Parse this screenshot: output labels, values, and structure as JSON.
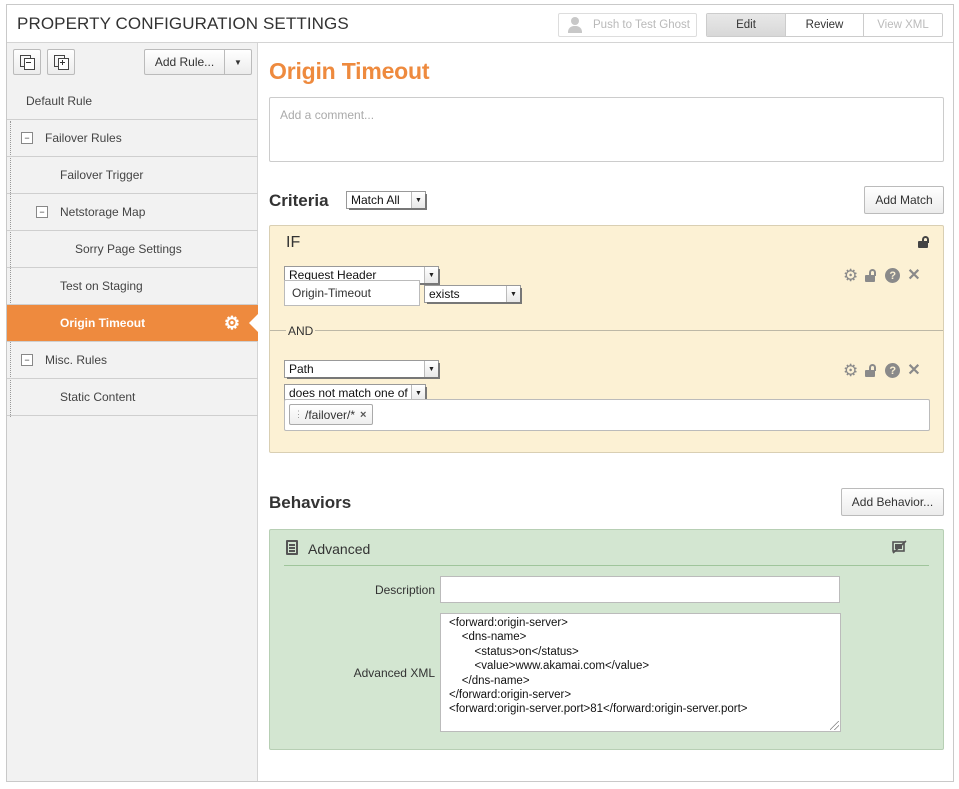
{
  "app": {
    "title": "PROPERTY CONFIGURATION SETTINGS",
    "push_button": "Push to Test Ghost",
    "modes": [
      "Edit",
      "Review",
      "View XML"
    ],
    "active_mode": "Edit"
  },
  "sidebar": {
    "add_rule_label": "Add Rule...",
    "rules": [
      {
        "label": "Default Rule",
        "level": 0,
        "toggle": ""
      },
      {
        "label": "Failover Rules",
        "level": 1,
        "toggle": "−"
      },
      {
        "label": "Failover Trigger",
        "level": 2,
        "toggle": ""
      },
      {
        "label": "Netstorage Map",
        "level": 2,
        "toggle": "−"
      },
      {
        "label": "Sorry Page Settings",
        "level": 3,
        "toggle": ""
      },
      {
        "label": "Test on Staging",
        "level": 2,
        "toggle": ""
      },
      {
        "label": "Origin Timeout",
        "level": 2,
        "toggle": "",
        "active": true
      },
      {
        "label": "Misc. Rules",
        "level": 1,
        "toggle": "−"
      },
      {
        "label": "Static Content",
        "level": 2,
        "toggle": ""
      }
    ]
  },
  "main": {
    "rule_title": "Origin Timeout",
    "comment_placeholder": "Add a comment...",
    "criteria": {
      "title": "Criteria",
      "match_mode": "Match All",
      "add_match_label": "Add Match",
      "if_label": "IF",
      "and_label": "AND",
      "condition1": {
        "type": "Request Header",
        "header_name": "Origin-Timeout",
        "operator": "exists"
      },
      "condition2": {
        "type": "Path",
        "operator": "does not match one of",
        "values": [
          "/failover/*"
        ]
      }
    },
    "behaviors": {
      "title": "Behaviors",
      "add_behavior_label": "Add Behavior...",
      "items": [
        {
          "name": "Advanced",
          "description_label": "Description",
          "description_value": "",
          "xml_label": "Advanced XML",
          "xml_value": "<forward:origin-server>\n    <dns-name>\n        <status>on</status>\n        <value>www.akamai.com</value>\n    </dns-name>\n</forward:origin-server>\n<forward:origin-server.port>81</forward:origin-server.port>"
        }
      ]
    }
  },
  "colors": {
    "accent": "#ee8a3e",
    "criteria_bg": "#fcf1d4",
    "behavior_bg": "#d3e6d1"
  },
  "icons": [
    "copy-rule-icon",
    "paste-rule-icon",
    "user-icon",
    "gear-icon",
    "lock-icon",
    "help-icon",
    "close-icon",
    "document-icon",
    "eye-off-icon"
  ]
}
